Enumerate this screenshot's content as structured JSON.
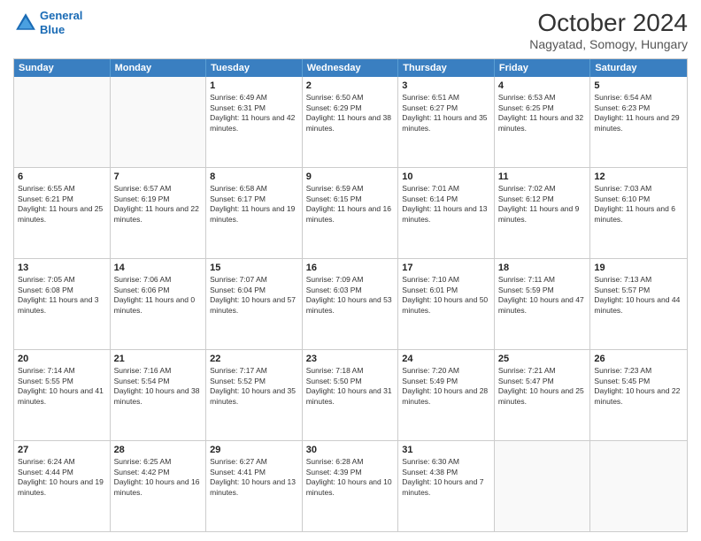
{
  "header": {
    "logo_line1": "General",
    "logo_line2": "Blue",
    "title": "October 2024",
    "subtitle": "Nagyatad, Somogy, Hungary"
  },
  "days_of_week": [
    "Sunday",
    "Monday",
    "Tuesday",
    "Wednesday",
    "Thursday",
    "Friday",
    "Saturday"
  ],
  "weeks": [
    [
      {
        "day": "",
        "empty": true
      },
      {
        "day": "",
        "empty": true
      },
      {
        "day": "1",
        "sunrise": "Sunrise: 6:49 AM",
        "sunset": "Sunset: 6:31 PM",
        "daylight": "Daylight: 11 hours and 42 minutes."
      },
      {
        "day": "2",
        "sunrise": "Sunrise: 6:50 AM",
        "sunset": "Sunset: 6:29 PM",
        "daylight": "Daylight: 11 hours and 38 minutes."
      },
      {
        "day": "3",
        "sunrise": "Sunrise: 6:51 AM",
        "sunset": "Sunset: 6:27 PM",
        "daylight": "Daylight: 11 hours and 35 minutes."
      },
      {
        "day": "4",
        "sunrise": "Sunrise: 6:53 AM",
        "sunset": "Sunset: 6:25 PM",
        "daylight": "Daylight: 11 hours and 32 minutes."
      },
      {
        "day": "5",
        "sunrise": "Sunrise: 6:54 AM",
        "sunset": "Sunset: 6:23 PM",
        "daylight": "Daylight: 11 hours and 29 minutes."
      }
    ],
    [
      {
        "day": "6",
        "sunrise": "Sunrise: 6:55 AM",
        "sunset": "Sunset: 6:21 PM",
        "daylight": "Daylight: 11 hours and 25 minutes."
      },
      {
        "day": "7",
        "sunrise": "Sunrise: 6:57 AM",
        "sunset": "Sunset: 6:19 PM",
        "daylight": "Daylight: 11 hours and 22 minutes."
      },
      {
        "day": "8",
        "sunrise": "Sunrise: 6:58 AM",
        "sunset": "Sunset: 6:17 PM",
        "daylight": "Daylight: 11 hours and 19 minutes."
      },
      {
        "day": "9",
        "sunrise": "Sunrise: 6:59 AM",
        "sunset": "Sunset: 6:15 PM",
        "daylight": "Daylight: 11 hours and 16 minutes."
      },
      {
        "day": "10",
        "sunrise": "Sunrise: 7:01 AM",
        "sunset": "Sunset: 6:14 PM",
        "daylight": "Daylight: 11 hours and 13 minutes."
      },
      {
        "day": "11",
        "sunrise": "Sunrise: 7:02 AM",
        "sunset": "Sunset: 6:12 PM",
        "daylight": "Daylight: 11 hours and 9 minutes."
      },
      {
        "day": "12",
        "sunrise": "Sunrise: 7:03 AM",
        "sunset": "Sunset: 6:10 PM",
        "daylight": "Daylight: 11 hours and 6 minutes."
      }
    ],
    [
      {
        "day": "13",
        "sunrise": "Sunrise: 7:05 AM",
        "sunset": "Sunset: 6:08 PM",
        "daylight": "Daylight: 11 hours and 3 minutes."
      },
      {
        "day": "14",
        "sunrise": "Sunrise: 7:06 AM",
        "sunset": "Sunset: 6:06 PM",
        "daylight": "Daylight: 11 hours and 0 minutes."
      },
      {
        "day": "15",
        "sunrise": "Sunrise: 7:07 AM",
        "sunset": "Sunset: 6:04 PM",
        "daylight": "Daylight: 10 hours and 57 minutes."
      },
      {
        "day": "16",
        "sunrise": "Sunrise: 7:09 AM",
        "sunset": "Sunset: 6:03 PM",
        "daylight": "Daylight: 10 hours and 53 minutes."
      },
      {
        "day": "17",
        "sunrise": "Sunrise: 7:10 AM",
        "sunset": "Sunset: 6:01 PM",
        "daylight": "Daylight: 10 hours and 50 minutes."
      },
      {
        "day": "18",
        "sunrise": "Sunrise: 7:11 AM",
        "sunset": "Sunset: 5:59 PM",
        "daylight": "Daylight: 10 hours and 47 minutes."
      },
      {
        "day": "19",
        "sunrise": "Sunrise: 7:13 AM",
        "sunset": "Sunset: 5:57 PM",
        "daylight": "Daylight: 10 hours and 44 minutes."
      }
    ],
    [
      {
        "day": "20",
        "sunrise": "Sunrise: 7:14 AM",
        "sunset": "Sunset: 5:55 PM",
        "daylight": "Daylight: 10 hours and 41 minutes."
      },
      {
        "day": "21",
        "sunrise": "Sunrise: 7:16 AM",
        "sunset": "Sunset: 5:54 PM",
        "daylight": "Daylight: 10 hours and 38 minutes."
      },
      {
        "day": "22",
        "sunrise": "Sunrise: 7:17 AM",
        "sunset": "Sunset: 5:52 PM",
        "daylight": "Daylight: 10 hours and 35 minutes."
      },
      {
        "day": "23",
        "sunrise": "Sunrise: 7:18 AM",
        "sunset": "Sunset: 5:50 PM",
        "daylight": "Daylight: 10 hours and 31 minutes."
      },
      {
        "day": "24",
        "sunrise": "Sunrise: 7:20 AM",
        "sunset": "Sunset: 5:49 PM",
        "daylight": "Daylight: 10 hours and 28 minutes."
      },
      {
        "day": "25",
        "sunrise": "Sunrise: 7:21 AM",
        "sunset": "Sunset: 5:47 PM",
        "daylight": "Daylight: 10 hours and 25 minutes."
      },
      {
        "day": "26",
        "sunrise": "Sunrise: 7:23 AM",
        "sunset": "Sunset: 5:45 PM",
        "daylight": "Daylight: 10 hours and 22 minutes."
      }
    ],
    [
      {
        "day": "27",
        "sunrise": "Sunrise: 6:24 AM",
        "sunset": "Sunset: 4:44 PM",
        "daylight": "Daylight: 10 hours and 19 minutes."
      },
      {
        "day": "28",
        "sunrise": "Sunrise: 6:25 AM",
        "sunset": "Sunset: 4:42 PM",
        "daylight": "Daylight: 10 hours and 16 minutes."
      },
      {
        "day": "29",
        "sunrise": "Sunrise: 6:27 AM",
        "sunset": "Sunset: 4:41 PM",
        "daylight": "Daylight: 10 hours and 13 minutes."
      },
      {
        "day": "30",
        "sunrise": "Sunrise: 6:28 AM",
        "sunset": "Sunset: 4:39 PM",
        "daylight": "Daylight: 10 hours and 10 minutes."
      },
      {
        "day": "31",
        "sunrise": "Sunrise: 6:30 AM",
        "sunset": "Sunset: 4:38 PM",
        "daylight": "Daylight: 10 hours and 7 minutes."
      },
      {
        "day": "",
        "empty": true
      },
      {
        "day": "",
        "empty": true
      }
    ]
  ]
}
